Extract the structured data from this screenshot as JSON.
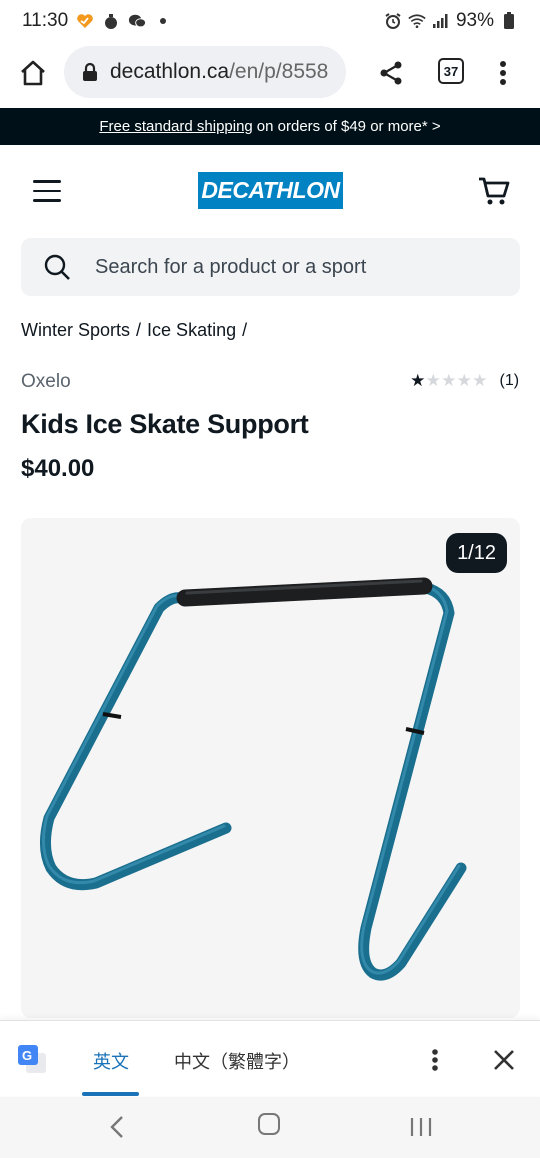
{
  "status_bar": {
    "time": "11:30",
    "battery": "93%"
  },
  "browser": {
    "url_domain": "decathlon.ca",
    "url_path": "/en/p/8558",
    "tab_count": "37"
  },
  "promo": {
    "link_text": "Free standard shipping",
    "rest_text": "on orders of $49 or more* >"
  },
  "header": {
    "logo_text": "DECATHLON"
  },
  "search": {
    "placeholder": "Search for a product or a sport"
  },
  "breadcrumb": [
    "Winter Sports",
    "/",
    "Ice Skating",
    "/"
  ],
  "product": {
    "brand": "Oxelo",
    "rating_value": 1,
    "rating_max": 5,
    "rating_count": "(1)",
    "title": "Kids Ice Skate Support",
    "price": "$40.00",
    "image_counter": "1/12"
  },
  "translate_bar": {
    "source_language": "英文",
    "target_language": "中文（繁體字）"
  },
  "colors": {
    "brand_blue": "#0082c3",
    "promo_bg": "#001018",
    "frame_blue": "#1a6e8e",
    "text_dark": "#101820"
  }
}
